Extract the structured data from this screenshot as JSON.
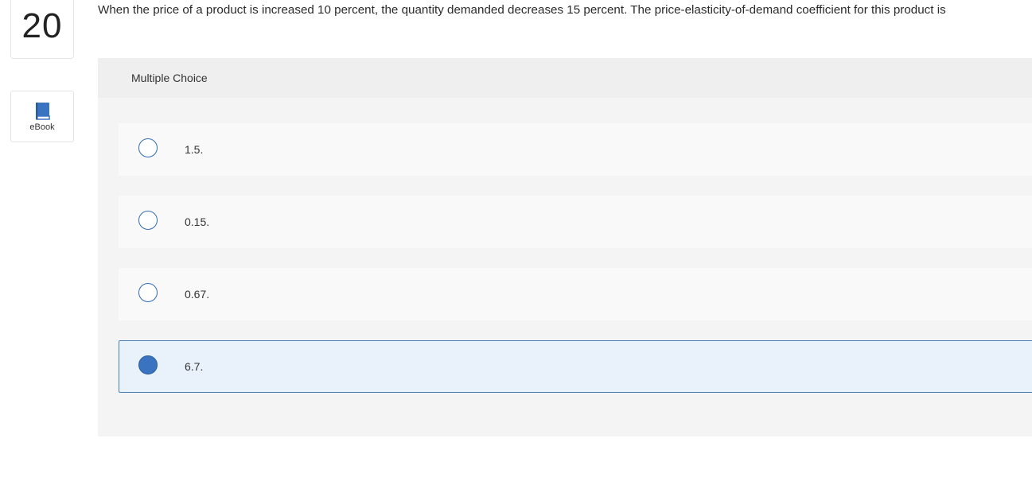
{
  "question": {
    "number": "20",
    "text": "When the price of a product is increased 10 percent, the quantity demanded decreases 15 percent. The price-elasticity-of-demand coefficient for this product is"
  },
  "ebook": {
    "label": "eBook",
    "icon": "book-icon"
  },
  "multiple_choice": {
    "header": "Multiple Choice",
    "options": [
      {
        "label": "1.5.",
        "selected": false
      },
      {
        "label": "0.15.",
        "selected": false
      },
      {
        "label": "0.67.",
        "selected": false
      },
      {
        "label": "6.7.",
        "selected": true
      }
    ]
  },
  "colors": {
    "accent": "#3a74c1",
    "selected_background": "#e9f2fb",
    "panel_background": "#f4f4f4"
  }
}
